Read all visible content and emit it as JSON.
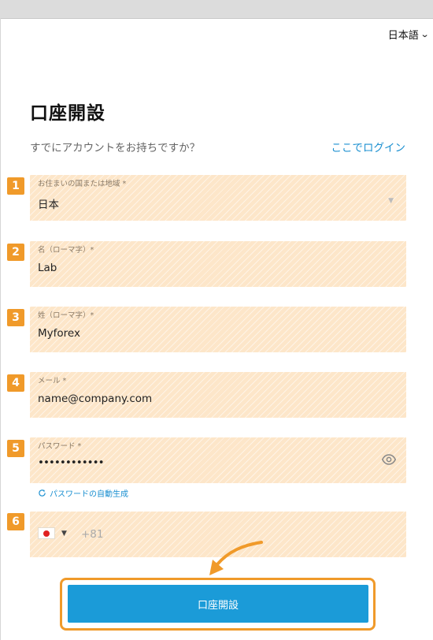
{
  "header": {
    "language": "日本語",
    "language_icon": "chevron-down-icon"
  },
  "page": {
    "title": "口座開設",
    "subtitle": "すでにアカウントをお持ちですか？",
    "login_link": "ここでログイン"
  },
  "form": {
    "country": {
      "badge": "1",
      "label": "お住まいの国または地域 *",
      "value": "日本"
    },
    "first_name": {
      "badge": "2",
      "label": "名（ローマ字）*",
      "value": "Lab"
    },
    "last_name": {
      "badge": "3",
      "label": "姓（ローマ字）*",
      "value": "Myforex"
    },
    "email": {
      "badge": "4",
      "label": "メール *",
      "value": "name@company.com"
    },
    "password": {
      "badge": "5",
      "label": "パスワード *",
      "value": "••••••••••••",
      "autogen": "パスワードの自動生成"
    },
    "phone": {
      "badge": "6",
      "dial_code": "+81"
    }
  },
  "submit": {
    "label": "口座開設"
  },
  "colors": {
    "accent": "#f09a2a",
    "primary": "#1b9bd8",
    "field_bg": "#fde6c9",
    "link": "#1a8fd0"
  }
}
